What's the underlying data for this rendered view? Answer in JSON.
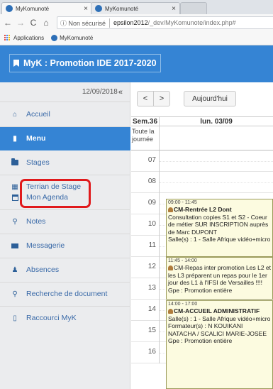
{
  "browser": {
    "tabs": [
      {
        "label": "MyKomunoté",
        "close": "×"
      },
      {
        "label": "MyKomunoté",
        "close": "×"
      },
      {
        "label": "",
        "close": ""
      }
    ],
    "nav": {
      "back": "←",
      "forward": "→",
      "reload": "C",
      "home": "⌂"
    },
    "address": {
      "security": "ⓘ Non sécurisé",
      "host": "epsilon2012",
      "path": "/_dev/MyKomunote/index.php#"
    },
    "bookmarks": [
      {
        "label": "Applications"
      },
      {
        "label": "MyKomunoté"
      }
    ]
  },
  "app": {
    "title": "MyK : Promotion IDE 2017-2020"
  },
  "sidebar": {
    "date": "12/09/2018",
    "collapse": "«",
    "items": [
      {
        "label": "Accueil",
        "icon": "home-icon",
        "glyph": "⌂"
      },
      {
        "label": "Menu",
        "icon": "book-icon",
        "glyph": "▮"
      },
      {
        "label": "Stages",
        "icon": "folder-icon",
        "glyph": ""
      },
      {
        "label": "Terrian de Stage",
        "icon": "building-icon",
        "glyph": "▦"
      },
      {
        "label": "Mon Agenda",
        "icon": "calendar-icon",
        "glyph": ""
      },
      {
        "label": "Notes",
        "icon": "pin-icon",
        "glyph": "⚲"
      },
      {
        "label": "Messagerie",
        "icon": "envelope-icon",
        "glyph": ""
      },
      {
        "label": "Absences",
        "icon": "person-icon",
        "glyph": "♟"
      },
      {
        "label": "Recherche de document",
        "icon": "search-icon",
        "glyph": "⚲"
      },
      {
        "label": "Raccourci MyK",
        "icon": "phone-icon",
        "glyph": "▯"
      }
    ]
  },
  "calendar": {
    "prev": "<",
    "next": ">",
    "today": "Aujourd'hui",
    "week": "Sem.36",
    "day": "lun. 03/09",
    "allday": "Toute la journée",
    "hours": [
      "07",
      "08",
      "09",
      "10",
      "11",
      "12",
      "13",
      "14",
      "15",
      "16"
    ],
    "events": [
      {
        "time": "09:00 - 11:45",
        "title": "CM-Rentrée L2 Dont",
        "body": "Consultation copies S1 et S2 - Coeur de métier SUR INSCRIPTION auprès de Marc DUPONT",
        "room": "Salle(s) : 1 - Salle Afrique vidéo+micro"
      },
      {
        "time": "11:45 - 14:00",
        "title": "CM-Repas inter promotion Les L2 et les L3 préparent un repas pour le 1er jour des L1 à l'IFSI de Versailles !!!!",
        "body": "",
        "room": "Gpe : Promotion entière"
      },
      {
        "time": "14:00 - 17:00",
        "title": "CM-ACCUEIL ADMINISTRATIF",
        "body": "Salle(s) : 1 - Salle Afrique vidéo+micro",
        "room": "Formateur(s) : N KOUIKANI NATACHA / SCALICI MARIE-JOSEE",
        "group": "Gpe : Promotion entière"
      }
    ]
  }
}
